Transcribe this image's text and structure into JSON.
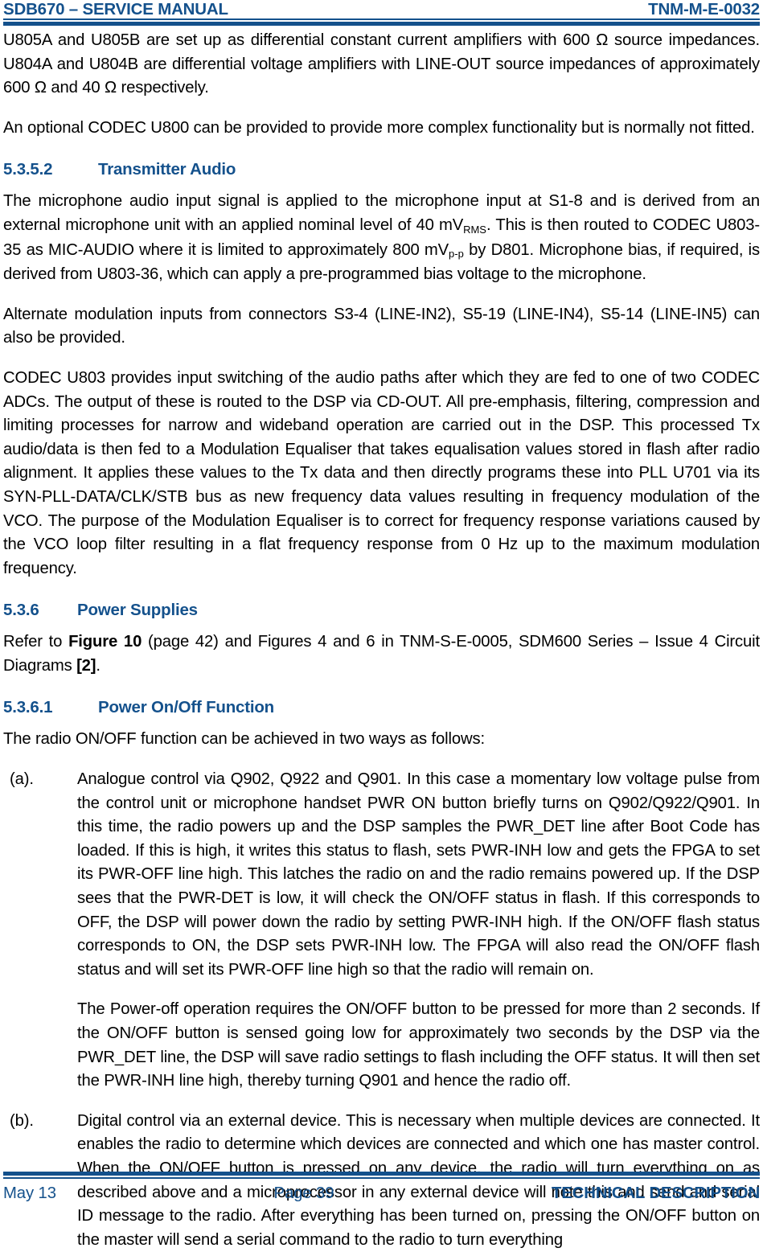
{
  "header": {
    "left": "SDB670 – SERVICE MANUAL",
    "right": "TNM-M-E-0032"
  },
  "body": {
    "para_amplifiers": "U805A and U805B are set up as differential constant current amplifiers with 600 Ω source impedances.   U804A and U804B are differential voltage amplifiers with LINE-OUT source impedances of approximately 600 Ω and 40 Ω respectively.",
    "para_codec_u800": "An optional CODEC U800 can be provided to provide more complex functionality but is normally not fitted.",
    "heading_5352": {
      "number": "5.3.5.2",
      "title": "Transmitter Audio"
    },
    "para_mic_1": "The microphone audio input signal is applied to the microphone input at S1-8 and is derived from an external microphone unit with an applied nominal level of 40 mV",
    "para_mic_sub1": "RMS",
    "para_mic_2": ".   This is then routed to CODEC U803-35 as MIC-AUDIO where it is limited to approximately 800 mV",
    "para_mic_sub2": "p-p",
    "para_mic_3": " by D801.  Microphone bias, if required, is derived from U803-36, which can apply a pre-programmed bias voltage to the microphone.",
    "para_alternate": "Alternate modulation inputs from connectors S3-4 (LINE-IN2), S5-19 (LINE-IN4), S5-14 (LINE-IN5) can also be provided.",
    "para_codec_u803": "CODEC U803 provides input switching of the audio paths after which they are fed to one of two CODEC ADCs.  The output of these is routed to the DSP via CD-OUT.  All pre-emphasis, filtering, compression and limiting processes for narrow and wideband operation are carried out in the DSP.  This processed Tx audio/data is then fed to a Modulation Equaliser that takes equalisation values stored in flash after radio alignment.   It applies these values to the Tx data and then directly programs these into PLL U701 via its SYN-PLL-DATA/CLK/STB bus as new frequency data values resulting in frequency modulation of the VCO.   The purpose of the Modulation Equaliser is to correct for frequency response variations caused by the VCO loop filter resulting in a flat frequency response from 0 Hz up to the maximum modulation frequency.",
    "heading_536": {
      "number": "5.3.6",
      "title": "Power Supplies"
    },
    "para_refer_1": "Refer to ",
    "para_refer_bold1": "Figure 10",
    "para_refer_2": " (page 42) and Figures 4 and 6 in TNM-S-E-0005, SDM600 Series – Issue 4 Circuit Diagrams ",
    "para_refer_bold2": "[2]",
    "para_refer_3": ".",
    "heading_5361": {
      "number": "5.3.6.1",
      "title": "Power On/Off Function"
    },
    "para_onoff_intro": "The radio ON/OFF function can be achieved in two ways as follows:",
    "item_a": {
      "marker": "(a).",
      "para1": "Analogue control via Q902, Q922 and Q901.   In this case a momentary low voltage pulse from the control unit or microphone handset PWR ON button briefly turns on Q902/Q922/Q901.   In this time, the radio powers up and the DSP samples the PWR_DET line after Boot Code has loaded.   If this is high, it writes this status to flash, sets PWR-INH low and gets the FPGA to set its PWR-OFF line high.   This latches the radio on and the radio remains powered up.   If the DSP sees that the PWR-DET is low, it will check the ON/OFF status in flash.   If this corresponds to OFF, the DSP will power down the radio by setting PWR-INH high.   If the ON/OFF flash status corresponds to ON, the DSP sets PWR-INH low.  The FPGA will also read the ON/OFF flash status and will set its PWR-OFF line high so that the radio will remain on.",
      "para2": "The Power-off operation requires the ON/OFF button to be pressed for more than 2 seconds.  If the ON/OFF button is sensed going low for approximately two seconds by the DSP via the PWR_DET line, the DSP will save radio settings to flash including the OFF status.  It will then set the PWR-INH line high, thereby turning Q901 and hence the radio off."
    },
    "item_b": {
      "marker": "(b).",
      "para1": "Digital control via an external device.   This is necessary when multiple devices are connected.   It enables the radio to determine which devices are connected and which one has master control.   When the ON/OFF button is pressed on any device, the radio will turn everything on as described above and a microprocessor in any external device will note this and send and serial ID message to the radio.   After everything has been turned on, pressing the ON/OFF button on the master will send a serial command to the radio to turn everything"
    }
  },
  "footer": {
    "left": "May 13",
    "center": "Page 39",
    "right": "TECHNICAL DESCRIPTION"
  },
  "colors": {
    "accent_blue": "#14518c",
    "text_black": "#000000"
  }
}
